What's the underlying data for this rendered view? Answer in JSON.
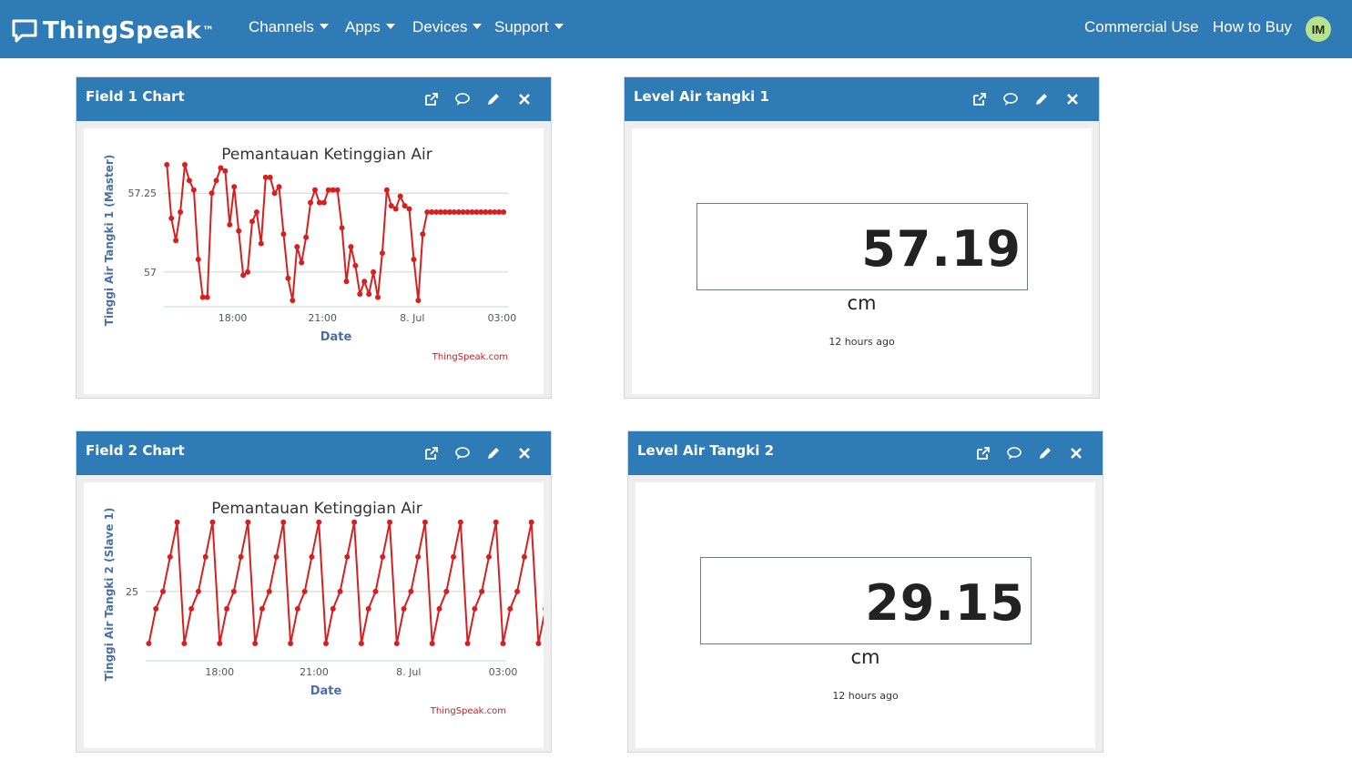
{
  "nav": {
    "brand": "ThingSpeak",
    "brand_tm": "™",
    "menu": [
      "Channels",
      "Apps",
      "Devices",
      "Support"
    ],
    "right": [
      "Commercial Use",
      "How to Buy"
    ],
    "avatar": "IM"
  },
  "panels": {
    "field1": {
      "title": "Field 1 Chart"
    },
    "level1": {
      "title": "Level Air tangki 1",
      "value": "57.19",
      "unit": "cm",
      "updated": "12 hours ago"
    },
    "field2": {
      "title": "Field 2 Chart"
    },
    "level2": {
      "title": "Level Air Tangki 2",
      "value": "29.15",
      "unit": "cm",
      "updated": "12 hours ago"
    }
  },
  "colors": {
    "nav": "#2f7bb6",
    "series": "#d62020",
    "axis_label": "#4a6fa5"
  },
  "icons": [
    "external-link-icon",
    "comment-icon",
    "pencil-icon",
    "close-icon"
  ],
  "chart_data": [
    {
      "type": "line",
      "title": "Pemantauan Ketinggian Air",
      "xlabel": "Date",
      "ylabel": "Tinggi Air Tangki 1 (Master)",
      "credit": "ThingSpeak.com",
      "x_ticks": [
        "18:00",
        "21:00",
        "8. Jul",
        "03:00"
      ],
      "x_tick_hours": [
        18,
        21,
        24,
        27
      ],
      "xlim": [
        15.7,
        27.2
      ],
      "y_ticks": [
        57.25,
        57
      ],
      "y_tick_labels": [
        "57.25",
        "57"
      ],
      "ylim": [
        56.89,
        57.34
      ],
      "x": [
        15.8,
        15.95,
        16.1,
        16.25,
        16.4,
        16.55,
        16.7,
        16.85,
        17.0,
        17.15,
        17.3,
        17.45,
        17.6,
        17.75,
        17.9,
        18.05,
        18.2,
        18.35,
        18.5,
        18.65,
        18.8,
        18.95,
        19.1,
        19.25,
        19.4,
        19.55,
        19.7,
        19.85,
        20.0,
        20.15,
        20.3,
        20.45,
        20.6,
        20.75,
        20.9,
        21.05,
        21.2,
        21.35,
        21.5,
        21.65,
        21.8,
        21.95,
        22.1,
        22.25,
        22.4,
        22.55,
        22.7,
        22.85,
        23.0,
        23.15,
        23.3,
        23.45,
        23.6,
        23.75,
        23.9,
        24.05,
        24.2,
        24.35,
        24.5,
        24.65,
        24.8,
        24.95,
        25.1,
        25.25,
        25.4,
        25.55,
        25.7,
        25.85,
        26.0,
        26.15,
        26.3,
        26.45,
        26.6,
        26.75,
        26.9,
        27.05
      ],
      "y": [
        57.34,
        57.17,
        57.1,
        57.19,
        57.34,
        57.29,
        57.26,
        57.04,
        56.92,
        56.92,
        57.25,
        57.29,
        57.33,
        57.32,
        57.15,
        57.27,
        57.13,
        56.99,
        57.0,
        57.16,
        57.19,
        57.09,
        57.3,
        57.3,
        57.25,
        57.27,
        57.12,
        56.98,
        56.91,
        57.08,
        57.03,
        57.11,
        57.22,
        57.26,
        57.22,
        57.22,
        57.26,
        57.26,
        57.26,
        57.14,
        56.97,
        57.08,
        57.02,
        56.93,
        56.97,
        56.93,
        57.0,
        56.92,
        57.06,
        57.26,
        57.21,
        57.2,
        57.24,
        57.21,
        57.2,
        57.04,
        56.91,
        57.12,
        57.19,
        57.19,
        57.19,
        57.19,
        57.19,
        57.19,
        57.19,
        57.19,
        57.19,
        57.19,
        57.19,
        57.19,
        57.19,
        57.19,
        57.19,
        57.19,
        57.19,
        57.19
      ]
    },
    {
      "type": "line",
      "title": "Pemantauan Ketinggian Air",
      "xlabel": "Date",
      "ylabel": "Tinggi Air Tangki 2 (Slave 1)",
      "credit": "ThingSpeak.com",
      "x_ticks": [
        "18:00",
        "21:00",
        "8. Jul",
        "03:00"
      ],
      "x_tick_hours": [
        18,
        21,
        24,
        27
      ],
      "xlim": [
        15.65,
        27.1
      ],
      "y_ticks": [
        25
      ],
      "y_tick_labels": [
        "25"
      ],
      "ylim": [
        21,
        29.2
      ],
      "pattern": "sawtooth",
      "pattern_levels": [
        22,
        24,
        25,
        27,
        29
      ],
      "pattern_start": 15.75,
      "pattern_step": 0.225,
      "pattern_cycles": 12
    }
  ]
}
